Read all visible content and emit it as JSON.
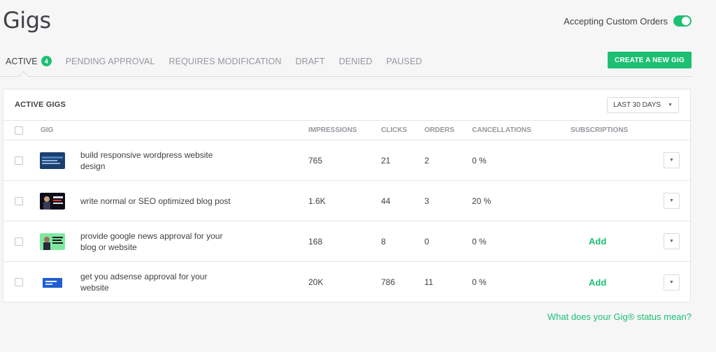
{
  "page": {
    "title": "Gigs",
    "accepting_label": "Accepting Custom Orders",
    "accepting_on": true
  },
  "tabs": [
    {
      "label": "ACTIVE",
      "count": "4",
      "active": true
    },
    {
      "label": "PENDING APPROVAL"
    },
    {
      "label": "REQUIRES MODIFICATION"
    },
    {
      "label": "DRAFT"
    },
    {
      "label": "DENIED"
    },
    {
      "label": "PAUSED"
    }
  ],
  "create_button": "CREATE A NEW GIG",
  "table": {
    "title": "ACTIVE GIGS",
    "range": "LAST 30 DAYS",
    "columns": [
      "GIG",
      "IMPRESSIONS",
      "CLICKS",
      "ORDERS",
      "CANCELLATIONS",
      "SUBSCRIPTIONS"
    ],
    "rows": [
      {
        "title": "build responsive wordpress website design",
        "impressions": "765",
        "clicks": "21",
        "orders": "2",
        "cancellations": "0 %",
        "subscriptions": ""
      },
      {
        "title": "write normal or SEO optimized blog post",
        "impressions": "1.6K",
        "clicks": "44",
        "orders": "3",
        "cancellations": "20 %",
        "subscriptions": ""
      },
      {
        "title": "provide google news approval for your blog or website",
        "impressions": "168",
        "clicks": "8",
        "orders": "0",
        "cancellations": "0 %",
        "subscriptions": "Add"
      },
      {
        "title": "get you adsense approval for your website",
        "impressions": "20K",
        "clicks": "786",
        "orders": "11",
        "cancellations": "0 %",
        "subscriptions": "Add"
      }
    ]
  },
  "help_link": "What does your Gig® status mean?",
  "colors": {
    "accent": "#1dbf73",
    "text": "#404145",
    "muted": "#95979d"
  }
}
